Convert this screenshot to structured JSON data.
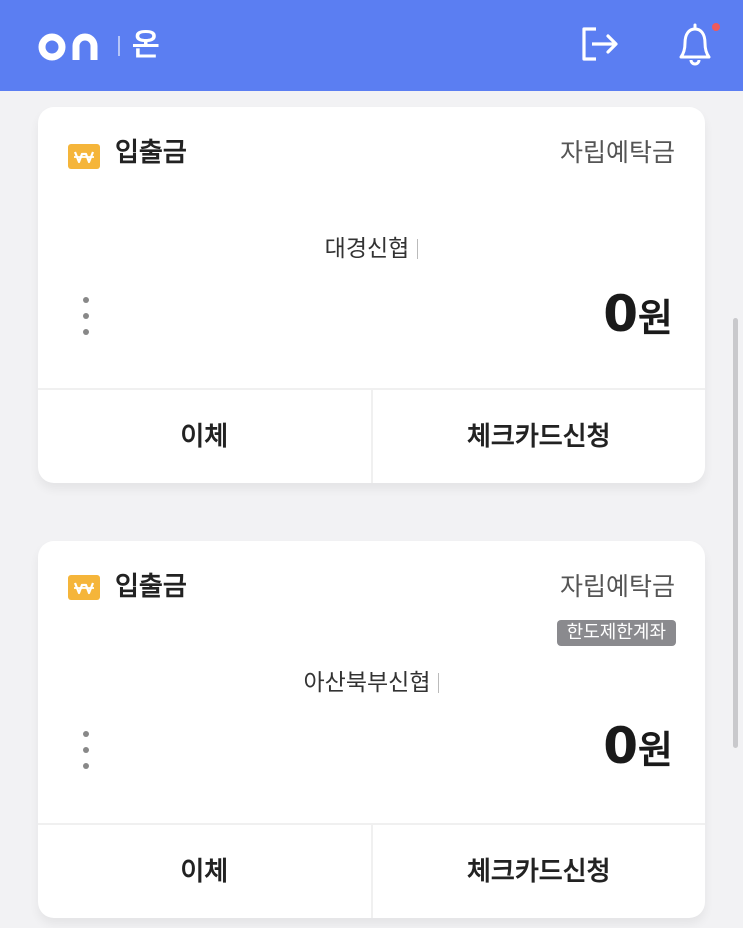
{
  "header": {
    "logo_kr": "온",
    "icons": [
      "logo-icon",
      "logout-icon",
      "bell-icon"
    ],
    "bg_color": "#5b7ef2",
    "notification_dot_color": "#f05a5a"
  },
  "accounts": [
    {
      "type": "입출금",
      "product": "자립예탁금",
      "bank": "대경신협",
      "amount": "0",
      "unit": "원",
      "actions": [
        "이체",
        "체크카드신청"
      ]
    },
    {
      "type": "입출금",
      "product": "자립예탁금",
      "badge": "한도제한계좌",
      "bank": "아산북부신협",
      "amount": "0",
      "unit": "원",
      "actions": [
        "이체",
        "체크카드신청"
      ]
    }
  ],
  "colors": {
    "won_badge": "#f5b53a",
    "limit_badge": "#8a8a8e"
  }
}
